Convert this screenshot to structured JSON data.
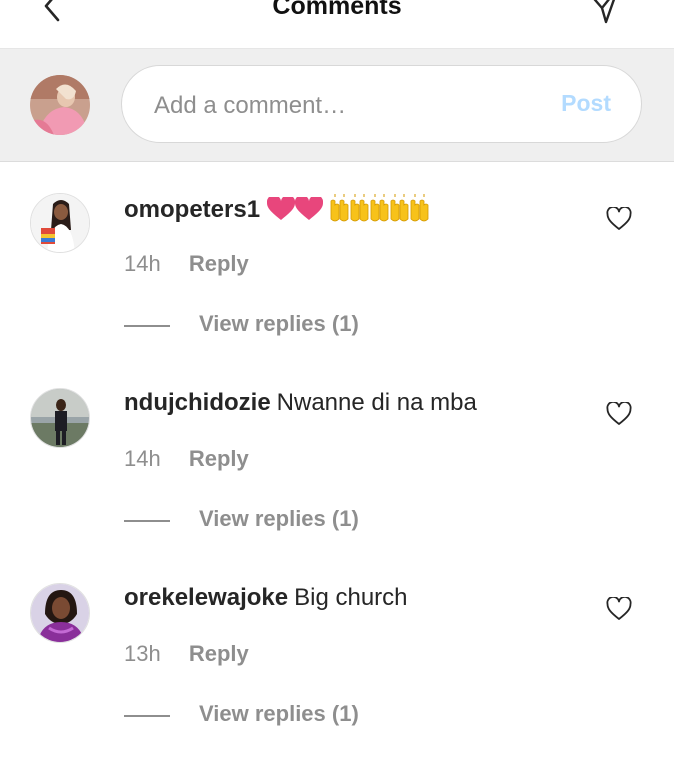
{
  "header": {
    "title": "Comments",
    "back_icon": "chevron-left-icon",
    "share_icon": "send-icon"
  },
  "composer": {
    "placeholder": "Add a comment…",
    "post_label": "Post",
    "post_color": "#b3dbff"
  },
  "comments": [
    {
      "username": "omopeters1",
      "text": "",
      "emojis": [
        "heart",
        "heart",
        "raised-hands",
        "raised-hands",
        "raised-hands",
        "raised-hands",
        "raised-hands"
      ],
      "time": "14h",
      "reply_label": "Reply",
      "view_replies": "View replies (1)"
    },
    {
      "username": "ndujchidozie",
      "text": "Nwanne di na mba",
      "time": "14h",
      "reply_label": "Reply",
      "view_replies": "View replies (1)"
    },
    {
      "username": "orekelewajoke",
      "text": "Big church",
      "time": "13h",
      "reply_label": "Reply",
      "view_replies": "View replies (1)"
    }
  ],
  "colors": {
    "heart": "#e8467c",
    "hands": "#f7c21a",
    "meta_text": "#8e8e8e",
    "composer_bg": "#efefef"
  }
}
